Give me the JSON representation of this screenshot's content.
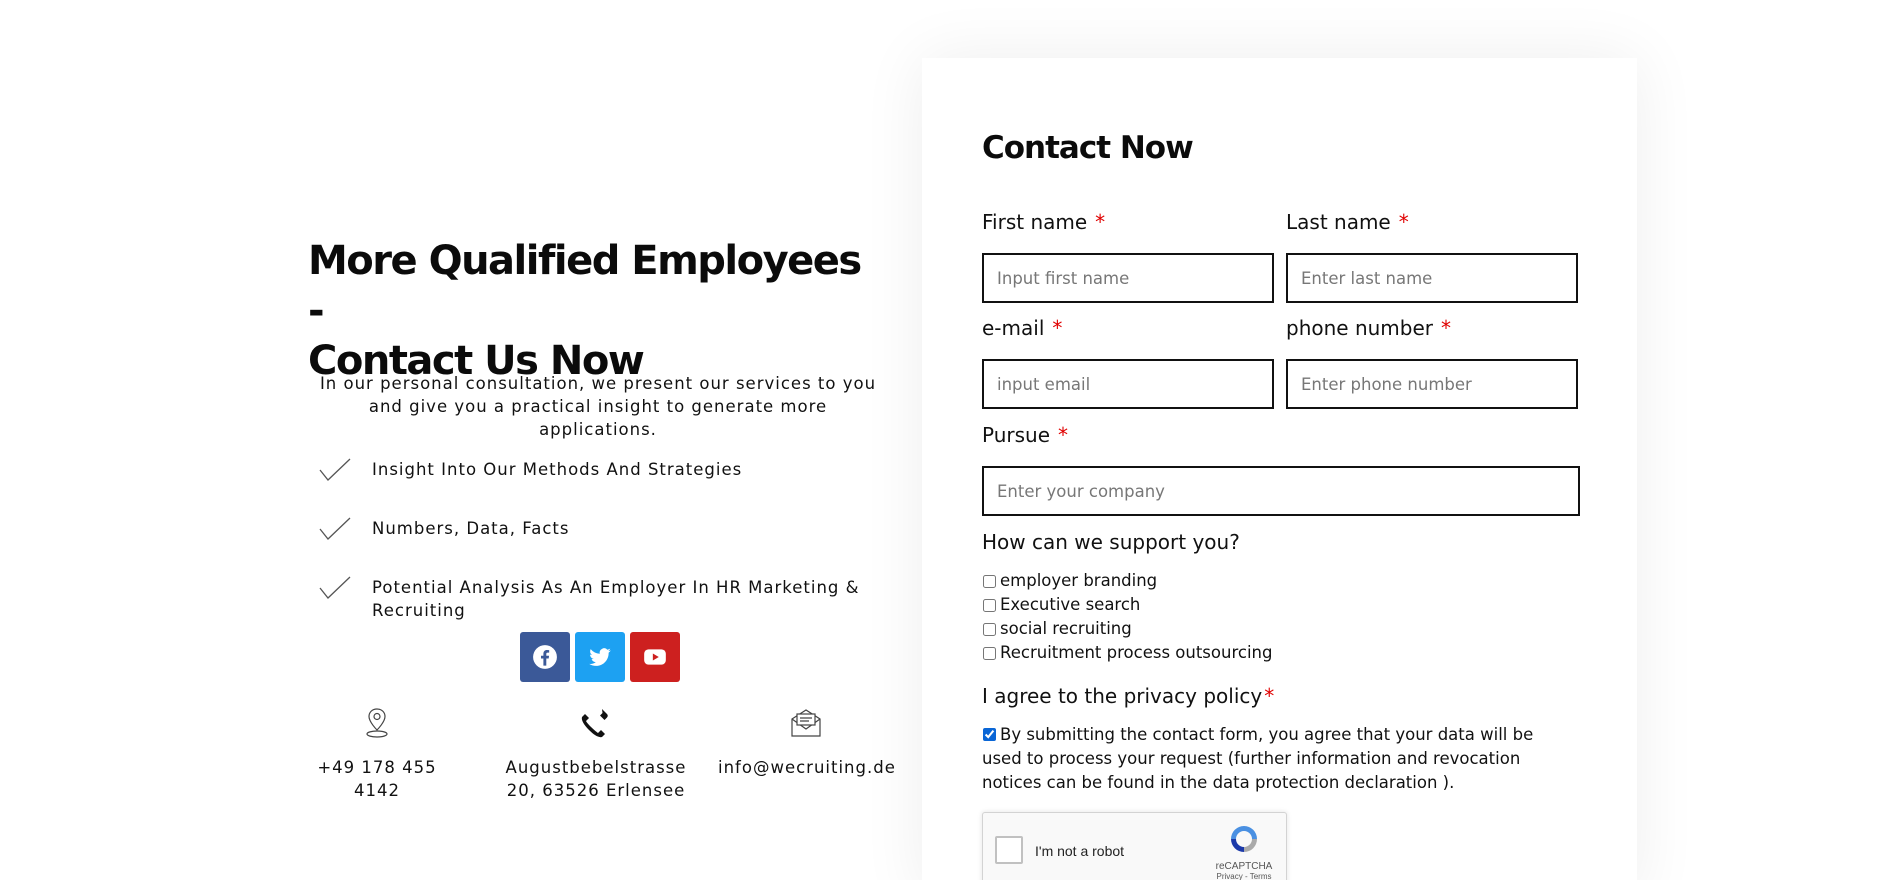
{
  "left": {
    "headline_line1": "More Qualified Employees -",
    "headline_line2": "Contact Us Now",
    "intro": "In our personal consultation, we present our services to you and give you a practical insight to generate more applications.",
    "features": [
      {
        "text": "Insight Into Our Methods And Strategies"
      },
      {
        "text": "Numbers, Data, Facts"
      },
      {
        "text": "Potential Analysis As An Employer In HR Marketing & Recruiting"
      }
    ],
    "socials": [
      {
        "name": "facebook",
        "icon": "facebook-icon",
        "color": "#3b5998"
      },
      {
        "name": "twitter",
        "icon": "twitter-icon",
        "color": "#1da1f2"
      },
      {
        "name": "youtube",
        "icon": "youtube-icon",
        "color": "#cd201f"
      }
    ],
    "contacts": {
      "phone": "+49 178 455 4142",
      "address_line1": "Augustbebelstrasse",
      "address_line2": "20, 63526 Erlensee",
      "email": "info@wecruiting.de"
    }
  },
  "form": {
    "title": "Contact Now",
    "required_marker": "*",
    "first_name": {
      "label": "First name",
      "placeholder": "Input first name",
      "value": ""
    },
    "last_name": {
      "label": "Last name",
      "placeholder": "Enter last name",
      "value": ""
    },
    "email": {
      "label": "e-mail",
      "placeholder": "input email",
      "value": ""
    },
    "phone": {
      "label": "phone number",
      "placeholder": "Enter phone number",
      "value": ""
    },
    "company": {
      "label": "Pursue",
      "placeholder": "Enter your company",
      "value": ""
    },
    "support_question": "How can we support you?",
    "support_options": [
      {
        "label": "employer branding",
        "checked": false
      },
      {
        "label": "Executive search",
        "checked": false
      },
      {
        "label": "social recruiting",
        "checked": false
      },
      {
        "label": "Recruitment process outsourcing",
        "checked": false
      }
    ],
    "privacy_label": "I agree to the privacy policy",
    "privacy_checked": true,
    "privacy_text": "By submitting the contact form, you agree that your data will be used to process your request (further information and revocation notices can be found in the data protection declaration ).",
    "captcha": {
      "label": "I'm not a robot",
      "brand": "reCAPTCHA",
      "links": "Privacy - Terms"
    }
  },
  "colors": {
    "required": "#e00000",
    "text": "#111111",
    "checkbox_accent": "#0a66d6"
  }
}
